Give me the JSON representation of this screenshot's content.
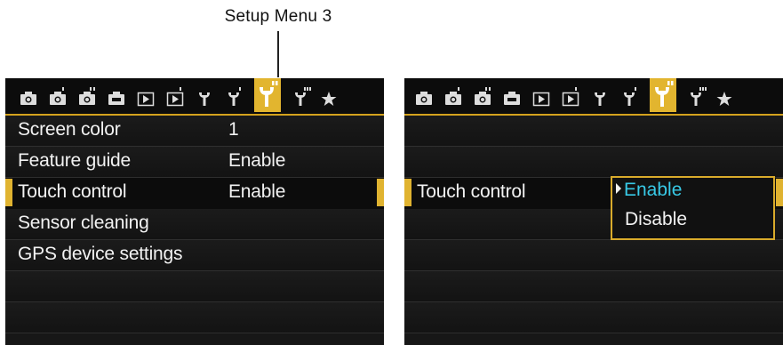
{
  "callout": {
    "label": "Setup Menu 3"
  },
  "tabs": [
    {
      "icon": "camera-icon"
    },
    {
      "icon": "camera-icon"
    },
    {
      "icon": "camera-icon"
    },
    {
      "icon": "camera-icon"
    },
    {
      "icon": "playback-icon"
    },
    {
      "icon": "playback-icon"
    },
    {
      "icon": "wrench-icon"
    },
    {
      "icon": "wrench-icon"
    },
    {
      "icon": "wrench-icon",
      "active": true
    },
    {
      "icon": "wrench-icon"
    },
    {
      "icon": "star-icon"
    }
  ],
  "left_screen": {
    "rows": [
      {
        "label": "Screen color",
        "value": "1"
      },
      {
        "label": "Feature guide",
        "value": "Enable"
      },
      {
        "label": "Touch control",
        "value": "Enable",
        "selected": true
      },
      {
        "label": "Sensor cleaning",
        "value": ""
      },
      {
        "label": "GPS device settings",
        "value": ""
      }
    ]
  },
  "right_screen": {
    "setting_label": "Touch control",
    "options": [
      "Enable",
      "Disable"
    ],
    "selected_option": "Enable"
  },
  "colors": {
    "accent": "#e0b330",
    "highlight_text": "#38c9e6",
    "screen_bg": "#171717"
  }
}
